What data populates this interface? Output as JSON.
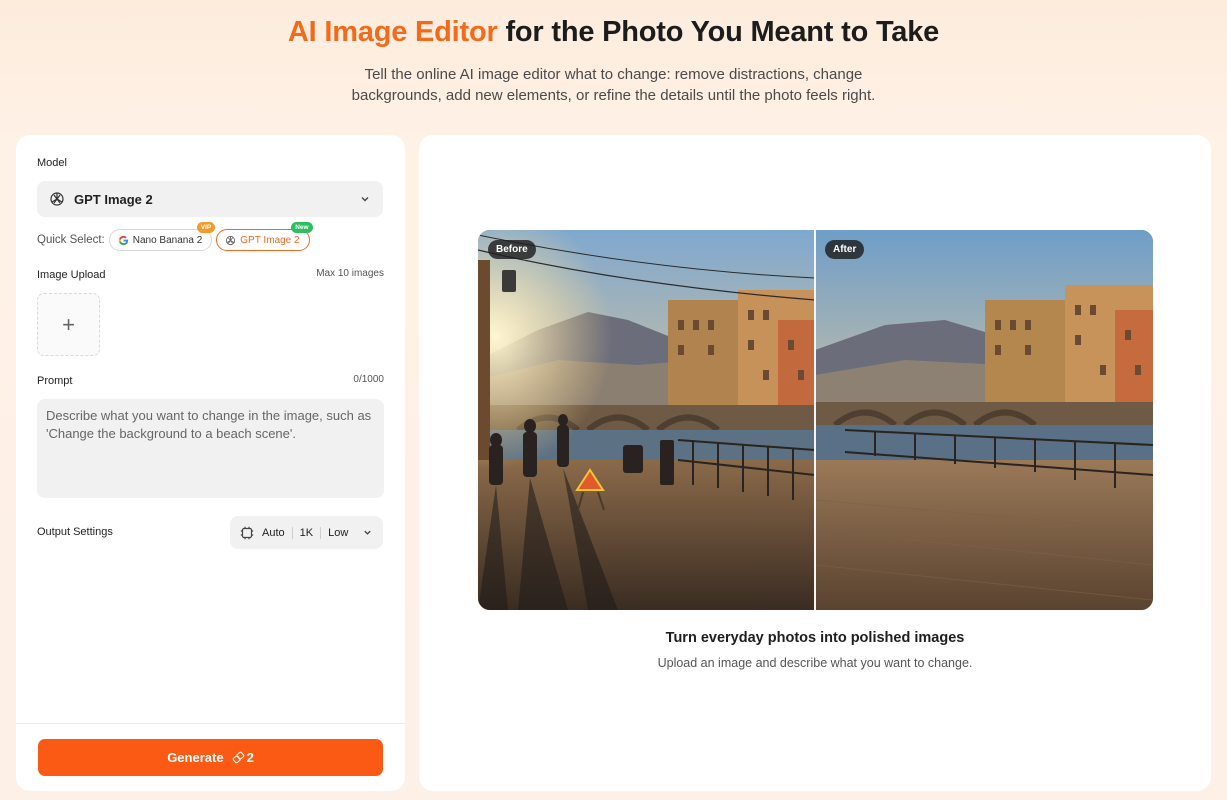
{
  "hero": {
    "title_accent": "AI Image Editor",
    "title_rest": " for the Photo You Meant to Take",
    "subtitle": "Tell the online AI image editor what to change: remove distractions, change backgrounds, add new elements, or refine the details until the photo feels right."
  },
  "form": {
    "model_label": "Model",
    "model_selected": "GPT Image 2",
    "quick_select_label": "Quick Select:",
    "quick_options": [
      {
        "label": "Nano Banana 2",
        "badge": "VIP",
        "icon": "google-icon",
        "active": false
      },
      {
        "label": "GPT Image 2",
        "badge": "New",
        "icon": "openai-icon",
        "active": true
      }
    ],
    "upload_label": "Image Upload",
    "upload_limit": "Max 10 images",
    "prompt_label": "Prompt",
    "prompt_counter": "0/1000",
    "prompt_placeholder": "Describe what you want to change in the image, such as 'Change the background to a beach scene'.",
    "output_label": "Output Settings",
    "output_ratio": "Auto",
    "output_resolution": "1K",
    "output_quality": "Low",
    "generate_label": "Generate",
    "generate_cost": "2"
  },
  "preview": {
    "before_tag": "Before",
    "after_tag": "After",
    "caption_title": "Turn everyday photos into polished images",
    "caption_sub": "Upload an image and describe what you want to change."
  },
  "colors": {
    "accent": "#f26a1b",
    "button": "#fa5a14",
    "vip_badge": "#f59a2a",
    "new_badge": "#2fbe5f"
  }
}
